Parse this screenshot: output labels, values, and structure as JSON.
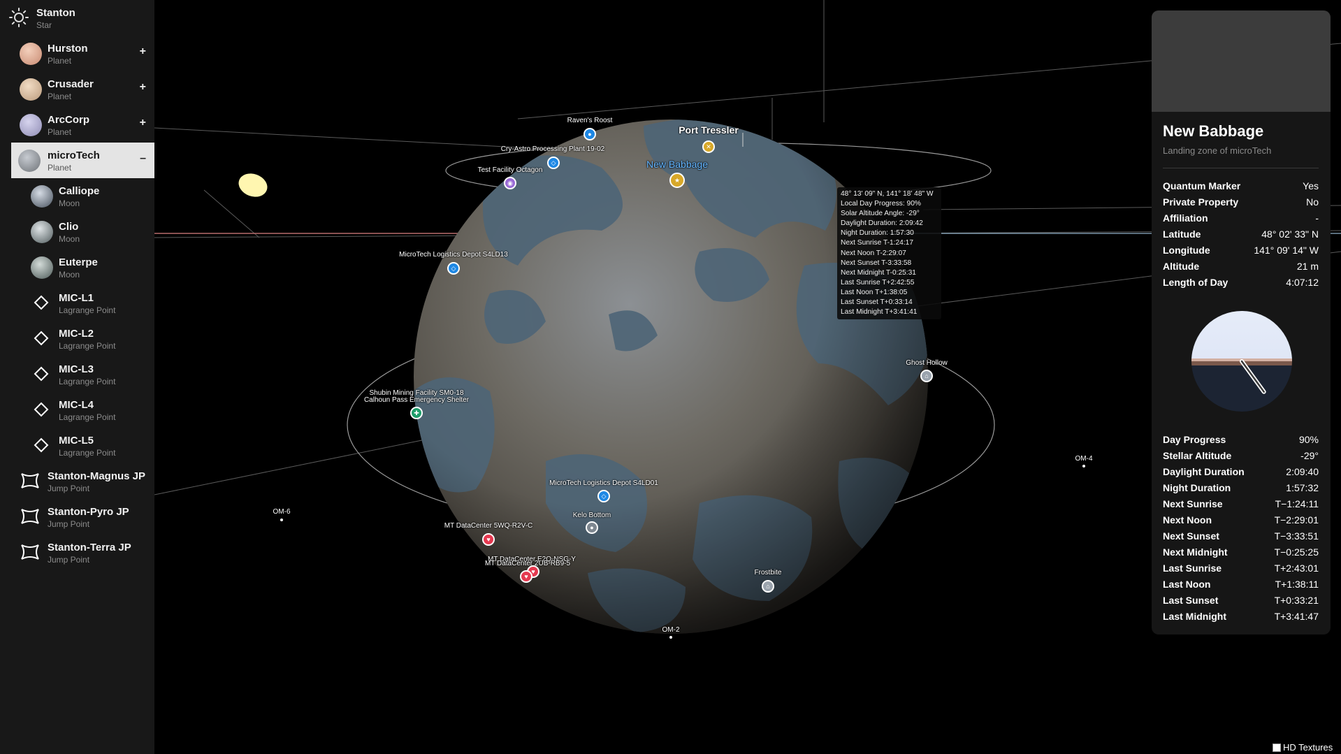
{
  "sidebar": {
    "items": [
      {
        "name": "Stanton",
        "type": "Star",
        "icon": "sun-icon",
        "toggle": ""
      },
      {
        "name": "Hurston",
        "type": "Planet",
        "icon": "hurston-planet-icon",
        "toggle": "+"
      },
      {
        "name": "Crusader",
        "type": "Planet",
        "icon": "crusader-planet-icon",
        "toggle": "+"
      },
      {
        "name": "ArcCorp",
        "type": "Planet",
        "icon": "arccorp-planet-icon",
        "toggle": "+"
      },
      {
        "name": "microTech",
        "type": "Planet",
        "icon": "microtech-planet-icon",
        "toggle": "–"
      },
      {
        "name": "Calliope",
        "type": "Moon",
        "icon": "calliope-moon-icon",
        "toggle": ""
      },
      {
        "name": "Clio",
        "type": "Moon",
        "icon": "clio-moon-icon",
        "toggle": ""
      },
      {
        "name": "Euterpe",
        "type": "Moon",
        "icon": "euterpe-moon-icon",
        "toggle": ""
      },
      {
        "name": "MIC-L1",
        "type": "Lagrange Point",
        "icon": "diamond-icon",
        "toggle": ""
      },
      {
        "name": "MIC-L2",
        "type": "Lagrange Point",
        "icon": "diamond-icon",
        "toggle": ""
      },
      {
        "name": "MIC-L3",
        "type": "Lagrange Point",
        "icon": "diamond-icon",
        "toggle": ""
      },
      {
        "name": "MIC-L4",
        "type": "Lagrange Point",
        "icon": "diamond-icon",
        "toggle": ""
      },
      {
        "name": "MIC-L5",
        "type": "Lagrange Point",
        "icon": "diamond-icon",
        "toggle": ""
      },
      {
        "name": "Stanton-Magnus JP",
        "type": "Jump Point",
        "icon": "jump-point-icon",
        "toggle": ""
      },
      {
        "name": "Stanton-Pyro JP",
        "type": "Jump Point",
        "icon": "jump-point-icon",
        "toggle": ""
      },
      {
        "name": "Stanton-Terra JP",
        "type": "Jump Point",
        "icon": "jump-point-icon",
        "toggle": ""
      }
    ],
    "selected": "microTech"
  },
  "map": {
    "labels": {
      "ravens_roost": "Raven's Roost",
      "port_tressler": "Port Tressler",
      "cry_astro": "Cry-Astro Processing Plant 19-02",
      "new_babbage": "New Babbage",
      "test_facility": "Test Facility Octagon",
      "logistics_s4ld13": "MicroTech Logistics Depot S4LD13",
      "ghost_hollow": "Ghost Hollow",
      "shubin": "Shubin Mining Facility SM0-18",
      "calhoun": "Calhoun Pass Emergency Shelter",
      "logistics_s4ld01": "MicroTech Logistics Depot S4LD01",
      "kelo_bottom": "Kelo Bottom",
      "dc_5wq": "MT DataCenter 5WQ-R2V-C",
      "dc_e2q": "MT DataCenter E2Q-NSG-Y",
      "dc_2ub": "MT DataCenter 2UB-RB9-5",
      "frostbite": "Frostbite",
      "om2": "OM-2",
      "om4": "OM-4",
      "om6": "OM-6"
    },
    "tooltip": [
      "48° 13' 09\" N, 141° 18' 48\" W",
      "Local Day Progress: 90%",
      "Solar Altitude Angle: -29°",
      "Daylight Duration: 2:09:42",
      "Night Duration: 1:57:30",
      "Next Sunrise T-1:24:17",
      "Next Noon T-2:29:07",
      "Next Sunset T-3:33:58",
      "Next Midnight T-0:25:31",
      "Last Sunrise T+2:42:55",
      "Last Noon T+1:38:05",
      "Last Sunset T+0:33:14",
      "Last Midnight T+3:41:41"
    ]
  },
  "panel": {
    "title": "New Babbage",
    "subtitle": "Landing zone of microTech",
    "properties": [
      {
        "key": "Quantum Marker",
        "value": "Yes"
      },
      {
        "key": "Private Property",
        "value": "No"
      },
      {
        "key": "Affiliation",
        "value": "-"
      },
      {
        "key": "Latitude",
        "value": "48° 02' 33\" N"
      },
      {
        "key": "Longitude",
        "value": "141° 09' 14\" W"
      },
      {
        "key": "Altitude",
        "value": "21 m"
      },
      {
        "key": "Length of Day",
        "value": "4:07:12"
      }
    ],
    "day_progress_fraction": 0.9,
    "times": [
      {
        "key": "Day Progress",
        "value": "90%"
      },
      {
        "key": "Stellar Altitude",
        "value": "-29°"
      },
      {
        "key": "Daylight Duration",
        "value": "2:09:40"
      },
      {
        "key": "Night Duration",
        "value": "1:57:32"
      },
      {
        "key": "Next Sunrise",
        "value": "T−1:24:11"
      },
      {
        "key": "Next Noon",
        "value": "T−2:29:01"
      },
      {
        "key": "Next Sunset",
        "value": "T−3:33:51"
      },
      {
        "key": "Next Midnight",
        "value": "T−0:25:25"
      },
      {
        "key": "Last Sunrise",
        "value": "T+2:43:01"
      },
      {
        "key": "Last Noon",
        "value": "T+1:38:11"
      },
      {
        "key": "Last Sunset",
        "value": "T+0:33:21"
      },
      {
        "key": "Last Midnight",
        "value": "T+3:41:47"
      }
    ]
  },
  "hd_textures": {
    "label": "HD Textures",
    "checked": false
  },
  "colors": {
    "sidebar_bg": "#181818",
    "selected_bg": "#e4e4e4",
    "panel_bg": "#161616",
    "marker_blue": "#1e88e5",
    "marker_red": "#e53950",
    "marker_gold": "#d8a829",
    "marker_purple": "#9a6ad6",
    "marker_green": "#1e9e6a",
    "sky_day": "#e6ecf9",
    "sky_night": "#1c2433"
  }
}
